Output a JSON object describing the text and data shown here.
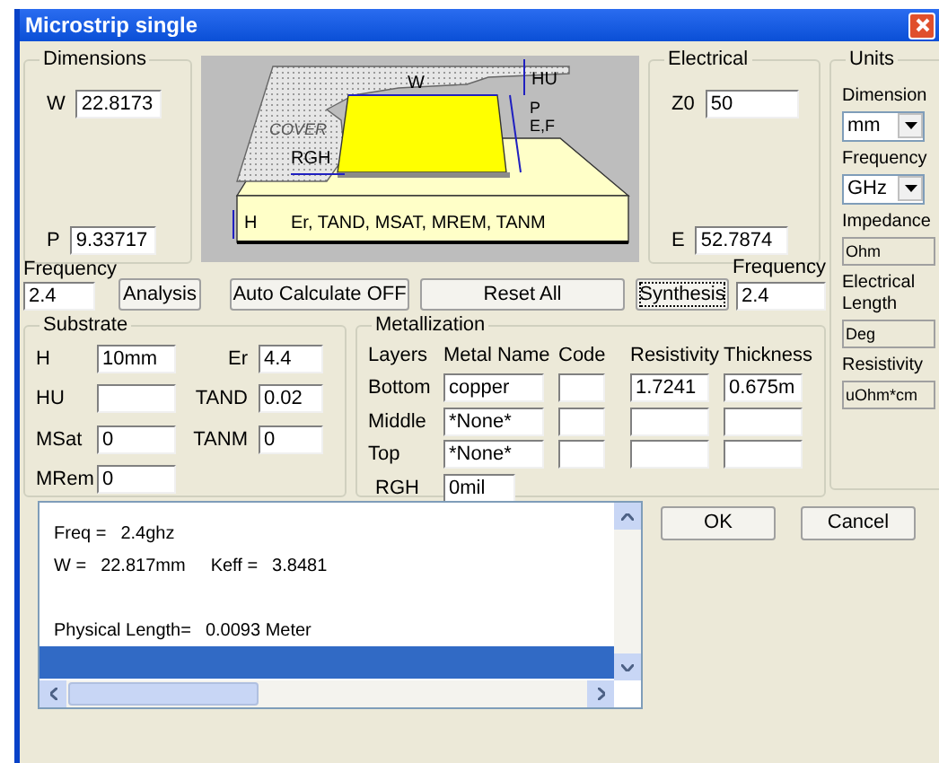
{
  "window": {
    "title": "Microstrip single"
  },
  "dimensions": {
    "title": "Dimensions",
    "fields": [
      {
        "label": "W",
        "value": "22.8173"
      },
      {
        "label": "P",
        "value": "9.33717"
      }
    ]
  },
  "diagram": {
    "labels": {
      "cover": "COVER",
      "w": "W",
      "hu": "HU",
      "p": "P",
      "ef": "E,F",
      "rgh": "RGH",
      "h": "H",
      "materials": "Er, TAND, MSAT, MREM, TANM"
    }
  },
  "electrical": {
    "title": "Electrical",
    "fields": [
      {
        "label": "Z0",
        "value": "50"
      },
      {
        "label": "E",
        "value": "52.7874"
      }
    ]
  },
  "units": {
    "title": "Units",
    "items": [
      {
        "kind": "select",
        "label": "Dimension",
        "value": "mm"
      },
      {
        "kind": "select",
        "label": "Frequency",
        "value": "GHz"
      },
      {
        "kind": "readonly",
        "label": "Impedance",
        "value": "Ohm"
      },
      {
        "kind": "readonly",
        "label": "Electrical Length",
        "value": "Deg"
      },
      {
        "kind": "readonly",
        "label": "Resistivity",
        "value": "uOhm*cm"
      }
    ]
  },
  "frequency_left": {
    "label": "Frequency",
    "value": "2.4"
  },
  "buttons": [
    {
      "label": "Analysis",
      "focused": false
    },
    {
      "label": "Auto Calculate OFF",
      "focused": false
    },
    {
      "label": "Reset  All",
      "focused": false
    },
    {
      "label": "Synthesis",
      "focused": true
    }
  ],
  "frequency_right": {
    "label": "Frequency",
    "value": "2.4"
  },
  "substrate": {
    "title": "Substrate",
    "fields": [
      {
        "label": "H",
        "value": "10mm"
      },
      {
        "label": "Er",
        "value": "4.4"
      },
      {
        "label": "HU"
      },
      {
        "label": "TAND",
        "value": "0.02"
      },
      {
        "label": "MSat",
        "value": "0"
      },
      {
        "label": "TANM",
        "value": "0"
      },
      {
        "label": "MRem",
        "value": "0"
      }
    ]
  },
  "metallization": {
    "title": "Metallization",
    "columns": [
      "Layers",
      "Metal Name",
      "Code",
      "Resistivity",
      "Thickness"
    ],
    "rows": [
      {
        "layer": "Bottom",
        "name": "copper",
        "resistivity": "1.7241",
        "thickness": "0.675m"
      },
      {
        "layer": "Middle",
        "name": "*None*"
      },
      {
        "layer": "Top",
        "name": "*None*"
      }
    ],
    "rgh": {
      "label": "RGH",
      "value": "0mil"
    }
  },
  "results": {
    "lines": [
      {
        "selected": false,
        "cells": [
          "Freq =",
          "2.4ghz"
        ]
      },
      {
        "selected": false,
        "cells": [
          "W =",
          "22.817mm",
          "Keff =",
          "3.8481"
        ]
      },
      {
        "selected": false
      },
      {
        "selected": false,
        "cells": [
          "Physical Length=",
          "0.0093 Meter"
        ]
      },
      {
        "selected": true
      }
    ]
  },
  "dialog_buttons": [
    "OK",
    "Cancel"
  ]
}
